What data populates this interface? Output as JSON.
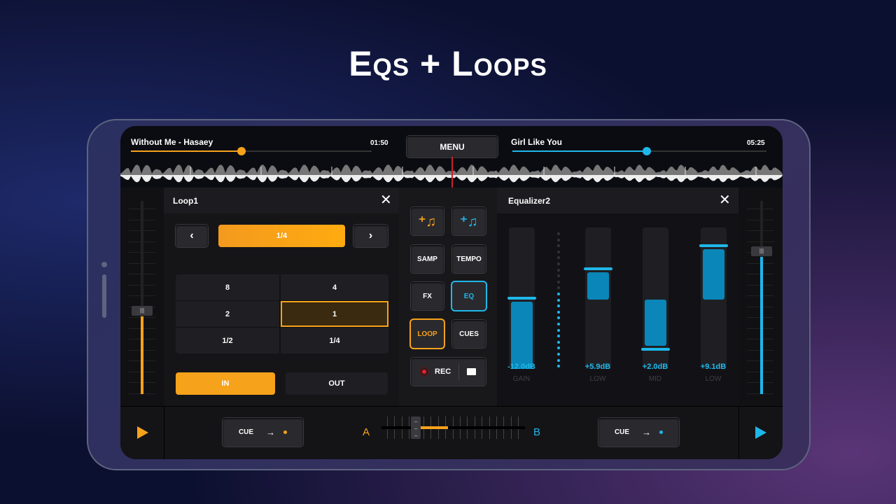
{
  "title": "Eqs + Loops",
  "colors": {
    "deckA": "#f7a21b",
    "deckB": "#1fb7ea",
    "playhead": "#d0202a"
  },
  "deckA": {
    "track": "Without Me - Hasaey",
    "time": "01:50",
    "progress": 0.46,
    "volume": 0.43,
    "cue_label": "CUE",
    "play_icon": "play-icon"
  },
  "deckB": {
    "track": "Girl Like You",
    "time": "05:25",
    "progress": 0.53,
    "volume": 0.74,
    "cue_label": "CUE",
    "play_icon": "play-icon"
  },
  "menu_label": "MENU",
  "loop": {
    "title": "Loop1",
    "selected_length": "1/4",
    "grid": [
      "8",
      "4",
      "2",
      "1",
      "1/2",
      "1/4"
    ],
    "selected_cell": "1",
    "in_label": "IN",
    "out_label": "OUT"
  },
  "center": {
    "buttons": [
      {
        "label": "SAMP"
      },
      {
        "label": "TEMPO"
      },
      {
        "label": "FX"
      },
      {
        "label": "EQ"
      },
      {
        "label": "LOOP"
      },
      {
        "label": "CUES"
      }
    ],
    "rec_label": "REC",
    "add_track_icon": "music-add-icon",
    "folder_icon": "folder-icon"
  },
  "equalizer": {
    "title": "Equalizer2",
    "bands": [
      {
        "value": "-12.0dB",
        "label": "GAIN",
        "level": 0.5
      },
      {
        "value": "+5.9dB",
        "label": "LOW",
        "level": 0.71
      },
      {
        "value": "+2.0dB",
        "label": "MID",
        "level": 0.14
      },
      {
        "value": "+9.1dB",
        "label": "LOW",
        "level": 0.87
      }
    ]
  },
  "crossfader": {
    "a_label": "A",
    "b_label": "B",
    "position": 0.24
  }
}
